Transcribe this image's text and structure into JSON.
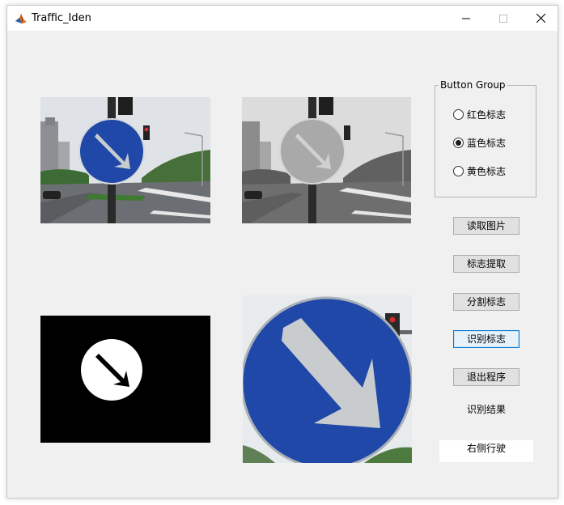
{
  "window": {
    "title": "Traffic_Iden"
  },
  "button_group": {
    "label": "Button Group",
    "options": [
      {
        "label": "红色标志",
        "selected": false
      },
      {
        "label": "蓝色标志",
        "selected": true
      },
      {
        "label": "黄色标志",
        "selected": false
      }
    ]
  },
  "buttons": {
    "read_image": "读取图片",
    "extract_sign": "标志提取",
    "segment_sign": "分割标志",
    "recognize_sign": "识别标志",
    "exit_program": "退出程序"
  },
  "result": {
    "label": "识别结果",
    "value": "右侧行驶"
  },
  "colors": {
    "sign_blue": "#1f48a8",
    "arrow_gray": "#c9cccf",
    "window_bg": "#f0f0f0",
    "focus_border": "#0078d7"
  }
}
